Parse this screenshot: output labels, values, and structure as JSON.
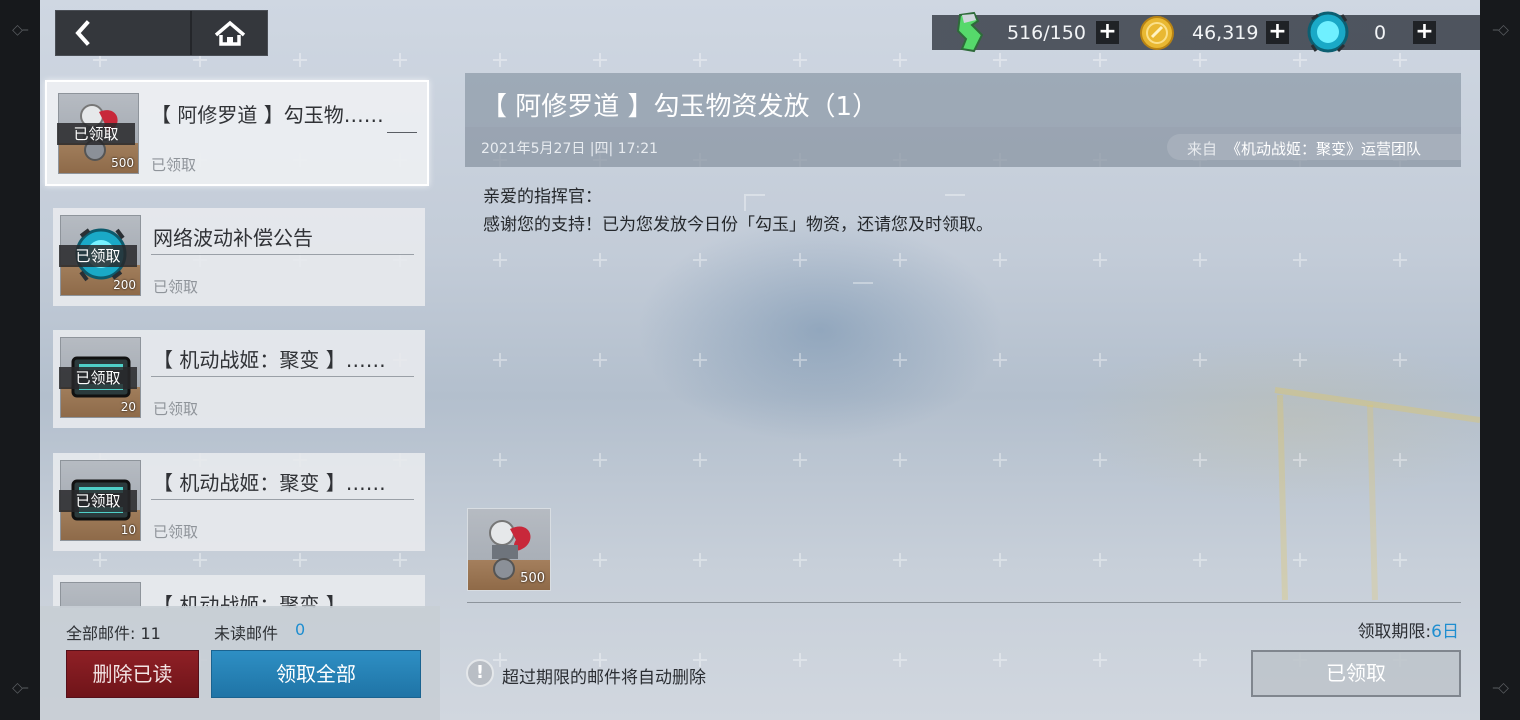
{
  "resources": [
    {
      "icon": "energy-icon",
      "value": "516/150"
    },
    {
      "icon": "coin-icon",
      "value": "46,319"
    },
    {
      "icon": "crystal-icon",
      "value": "0"
    }
  ],
  "mail_list": [
    {
      "title": "【 阿修罗道 】勾玉物……",
      "status": "已领取",
      "badge": "已领取",
      "qty": "500",
      "item_icon": "magatama-icon",
      "selected": true
    },
    {
      "title": "网络波动补偿公告",
      "status": "已领取",
      "badge": "已领取",
      "qty": "200",
      "item_icon": "crystal-icon",
      "selected": false
    },
    {
      "title": "【 机动战姬：聚变 】……",
      "status": "已领取",
      "badge": "已领取",
      "qty": "20",
      "item_icon": "ticket-icon",
      "selected": false
    },
    {
      "title": "【 机动战姬：聚变 】……",
      "status": "已领取",
      "badge": "已领取",
      "qty": "10",
      "item_icon": "ticket-icon",
      "selected": false
    },
    {
      "title": "【 机动战姬：聚变 】……",
      "status": "",
      "badge": "",
      "qty": "",
      "item_icon": "ticket-icon",
      "selected": false
    }
  ],
  "footer": {
    "total_label": "全部邮件: 11",
    "unread_label": "未读邮件",
    "unread_count": "0",
    "delete_read": "删除已读",
    "claim_all": "领取全部"
  },
  "detail": {
    "title": "【 阿修罗道 】勾玉物资发放（1）",
    "date": "2021年5月27日 |四|  17:21",
    "from_label": "来自",
    "from": "《机动战姬：聚变》运营团队",
    "greeting": "亲爱的指挥官：",
    "body": "感谢您的支持！已为您发放今日份「勾玉」物资，还请您及时领取。",
    "reward_qty": "500",
    "deadline_label": "领取期限:",
    "deadline_value": "6日",
    "warning": "超过期限的邮件将自动删除",
    "claimed_button": "已领取"
  }
}
